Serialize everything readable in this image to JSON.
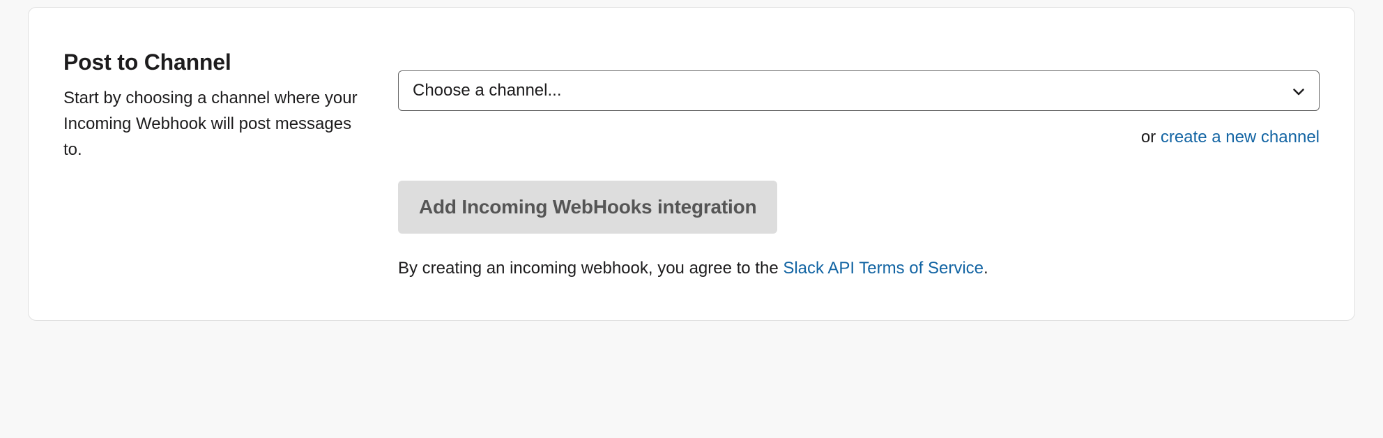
{
  "section": {
    "title": "Post to Channel",
    "description": "Start by choosing a channel where your Incoming Webhook will post messages to."
  },
  "select": {
    "placeholder": "Choose a channel..."
  },
  "alt_action": {
    "prefix": "or ",
    "link_text": "create a new channel"
  },
  "buttons": {
    "add_integration": "Add Incoming WebHooks integration"
  },
  "terms": {
    "prefix": "By creating an incoming webhook, you agree to the ",
    "link_text": "Slack API Terms of Service",
    "suffix": "."
  }
}
